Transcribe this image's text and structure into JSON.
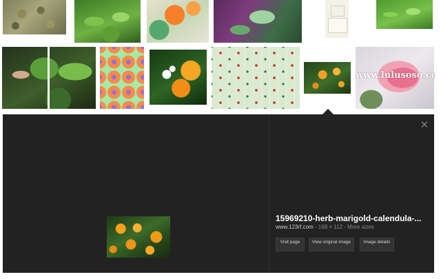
{
  "results": {
    "row1": [
      {
        "name": "dried-herb-tea"
      },
      {
        "name": "mint-leaves"
      },
      {
        "name": "orange-flower-artwork"
      },
      {
        "name": "fuchsia-plant"
      },
      {
        "name": "perfume-bottle"
      },
      {
        "name": "green-mint-bush"
      }
    ],
    "row2": [
      {
        "name": "hand-holding-basil"
      },
      {
        "name": "orange-flower-pattern"
      },
      {
        "name": "orange-blossom-fruit"
      },
      {
        "name": "floral-fabric"
      },
      {
        "name": "marigold-selected"
      },
      {
        "name": "pink-rose"
      }
    ],
    "watermark": "www.lulusoso.com"
  },
  "preview": {
    "close_glyph": "✕",
    "title": "15969210-herb-marigold-calendula-...",
    "domain": "www.123rf.com",
    "size_text": " - 168 × 112 - More sizes",
    "buttons": {
      "visit": "Visit page",
      "original": "View original image",
      "details": "Image details"
    }
  }
}
